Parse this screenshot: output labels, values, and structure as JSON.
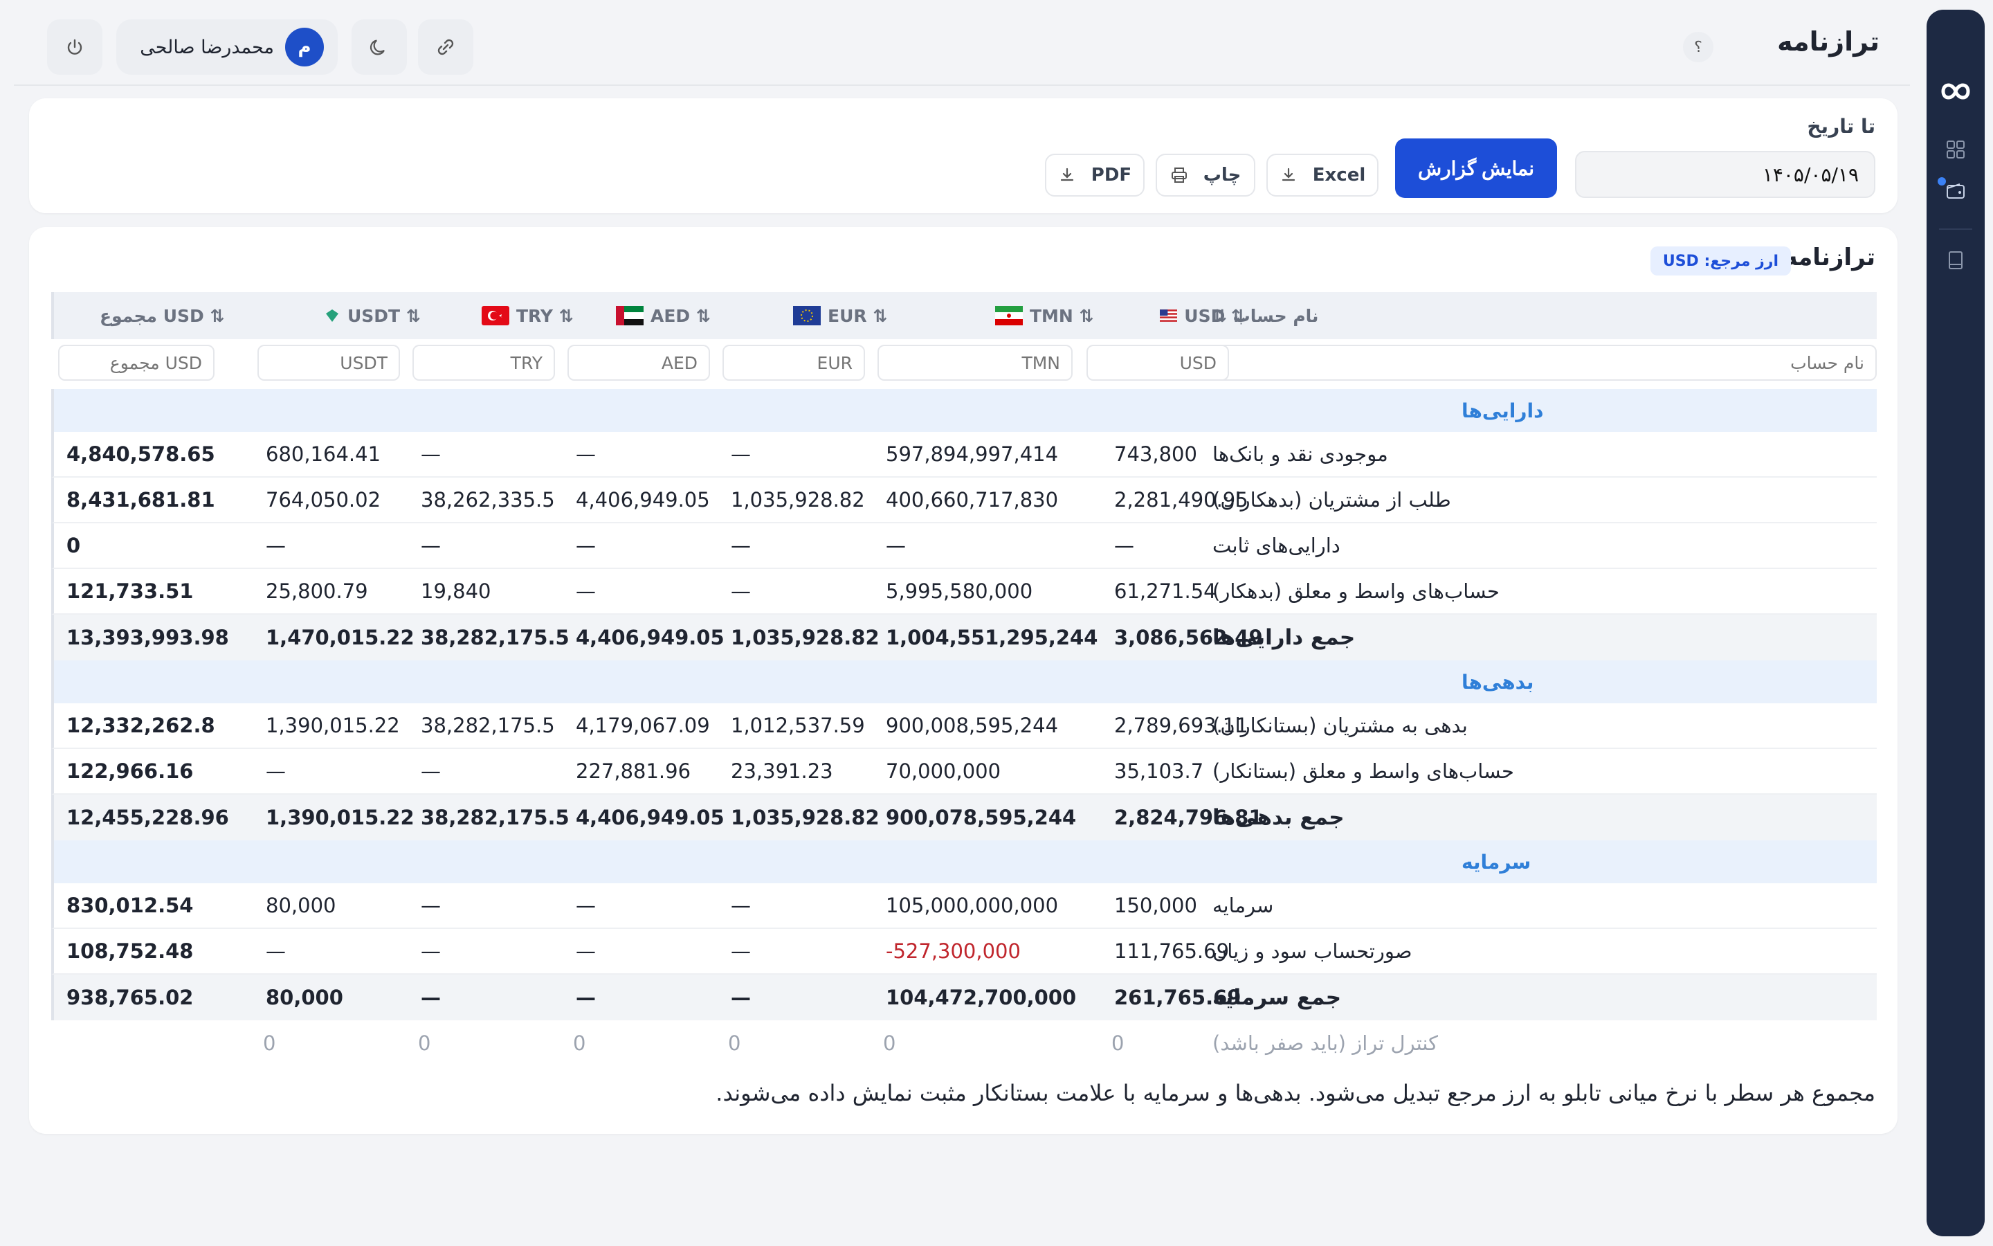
{
  "header": {
    "title": "ترازنامه",
    "help": "؟",
    "user_name": "محمدرضا صالحی",
    "user_initial": "م"
  },
  "filter": {
    "date_label": "تا تاریخ",
    "date_value": "۱۴۰۵/۰۵/۱۹",
    "show_report": "نمایش گزارش",
    "excel": "Excel",
    "print": "چاپ",
    "pdf": "PDF"
  },
  "table": {
    "title": "ترازنامه",
    "ref_currency": "ارز مرجع: USD",
    "columns": {
      "name": "نام حساب ⇅",
      "usd": "USD ⇅",
      "tmn": "TMN ⇅",
      "eur": "EUR ⇅",
      "aed": "AED ⇅",
      "try": "TRY ⇅",
      "usdt": "USDT ⇅",
      "total": "مجموع USD ⇅"
    },
    "filters": {
      "name": "نام حساب",
      "usd": "USD",
      "tmn": "TMN",
      "eur": "EUR",
      "aed": "AED",
      "try": "TRY",
      "usdt": "USDT",
      "total": "مجموع USD"
    },
    "sections": {
      "assets": "دارایی‌ها",
      "liabilities": "بدهی‌ها",
      "equity": "سرمایه"
    },
    "rows": [
      {
        "name": "موجودی نقد و بانک‌ها",
        "usd": "743,800",
        "tmn": "597,894,997,414",
        "eur": "—",
        "aed": "—",
        "try": "—",
        "usdt": "680,164.41",
        "total": "4,840,578.65"
      },
      {
        "name": "طلب از مشتریان (بدهکاران)",
        "usd": "2,281,490.95",
        "tmn": "400,660,717,830",
        "eur": "1,035,928.82",
        "aed": "4,406,949.05",
        "try": "38,262,335.5",
        "usdt": "764,050.02",
        "total": "8,431,681.81"
      },
      {
        "name": "دارایی‌های ثابت",
        "usd": "—",
        "tmn": "—",
        "eur": "—",
        "aed": "—",
        "try": "—",
        "usdt": "—",
        "total": "0"
      },
      {
        "name": "حساب‌های واسط و معلق (بدهکار)",
        "usd": "61,271.54",
        "tmn": "5,995,580,000",
        "eur": "—",
        "aed": "—",
        "try": "19,840",
        "usdt": "25,800.79",
        "total": "121,733.51"
      },
      {
        "name": "جمع دارایی‌ها",
        "usd": "3,086,562.49",
        "tmn": "1,004,551,295,244",
        "eur": "1,035,928.82",
        "aed": "4,406,949.05",
        "try": "38,282,175.5",
        "usdt": "1,470,015.22",
        "total": "13,393,993.98"
      },
      {
        "name": "بدهی به مشتریان (بستانکاران)",
        "usd": "2,789,693.11",
        "tmn": "900,008,595,244",
        "eur": "1,012,537.59",
        "aed": "4,179,067.09",
        "try": "38,282,175.5",
        "usdt": "1,390,015.22",
        "total": "12,332,262.8"
      },
      {
        "name": "حساب‌های واسط و معلق (بستانکار)",
        "usd": "35,103.7",
        "tmn": "70,000,000",
        "eur": "23,391.23",
        "aed": "227,881.96",
        "try": "—",
        "usdt": "—",
        "total": "122,966.16"
      },
      {
        "name": "جمع بدهی‌ها",
        "usd": "2,824,796.81",
        "tmn": "900,078,595,244",
        "eur": "1,035,928.82",
        "aed": "4,406,949.05",
        "try": "38,282,175.5",
        "usdt": "1,390,015.22",
        "total": "12,455,228.96"
      },
      {
        "name": "سرمایه",
        "usd": "150,000",
        "tmn": "105,000,000,000",
        "eur": "—",
        "aed": "—",
        "try": "—",
        "usdt": "80,000",
        "total": "830,012.54"
      },
      {
        "name": "صورتحساب سود و زیان",
        "usd": "111,765.69",
        "tmn": "-527,300,000",
        "eur": "—",
        "aed": "—",
        "try": "—",
        "usdt": "—",
        "total": "108,752.48"
      },
      {
        "name": "جمع سرمایه",
        "usd": "261,765.69",
        "tmn": "104,472,700,000",
        "eur": "—",
        "aed": "—",
        "try": "—",
        "usdt": "80,000",
        "total": "938,765.02"
      },
      {
        "name": "کنترل تراز (باید صفر باشد)",
        "usd": "0",
        "tmn": "0",
        "eur": "0",
        "aed": "0",
        "try": "0",
        "usdt": "0",
        "total": ""
      }
    ],
    "footnote": "مجموع هر سطر با نرخ میانی تابلو به ارز مرجع تبدیل می‌شود. بدهی‌ها و سرمایه با علامت بستانکار مثبت نمایش داده می‌شوند."
  },
  "colors": {
    "primary": "#1d4ed8",
    "sidebar": "#1d2943",
    "section_text": "#2f7fd8",
    "negative": "#c0262d"
  },
  "icons": [
    "infinity-logo-icon",
    "grid-icon",
    "wallet-icon",
    "book-icon",
    "power-icon",
    "moon-icon",
    "link-icon",
    "download-icon",
    "printer-icon",
    "sort-icon"
  ]
}
